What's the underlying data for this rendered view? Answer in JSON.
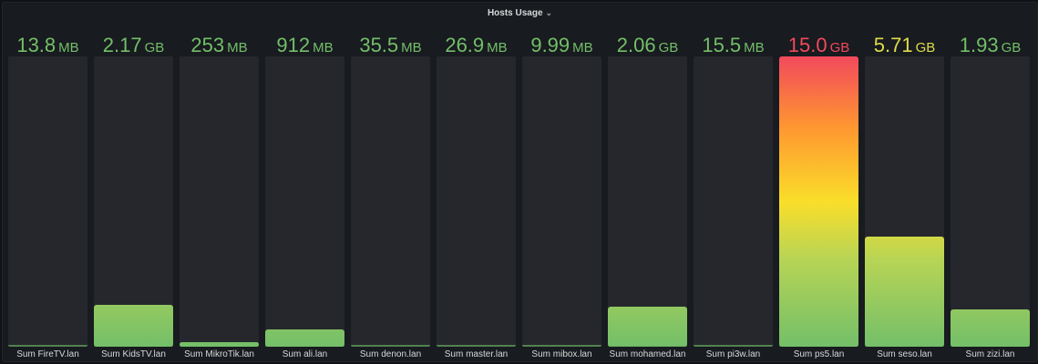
{
  "panel": {
    "title": "Hosts Usage",
    "chevron_icon": "chevron-down-icon"
  },
  "scale": {
    "min_gb": 0,
    "max_gb": 15.0
  },
  "colors": {
    "green": "#73bf69",
    "yellow": "#fade2a",
    "red": "#f2495c"
  },
  "bars": [
    {
      "label": "Sum FireTV.lan",
      "value": "13.8",
      "unit": "MB",
      "gb": 0.0138,
      "color": "#73bf69"
    },
    {
      "label": "Sum KidsTV.lan",
      "value": "2.17",
      "unit": "GB",
      "gb": 2.17,
      "color": "#73bf69"
    },
    {
      "label": "Sum MikroTik.lan",
      "value": "253",
      "unit": "MB",
      "gb": 0.253,
      "color": "#73bf69"
    },
    {
      "label": "Sum ali.lan",
      "value": "912",
      "unit": "MB",
      "gb": 0.912,
      "color": "#73bf69"
    },
    {
      "label": "Sum denon.lan",
      "value": "35.5",
      "unit": "MB",
      "gb": 0.0355,
      "color": "#73bf69"
    },
    {
      "label": "Sum master.lan",
      "value": "26.9",
      "unit": "MB",
      "gb": 0.0269,
      "color": "#73bf69"
    },
    {
      "label": "Sum mibox.lan",
      "value": "9.99",
      "unit": "MB",
      "gb": 0.00999,
      "color": "#73bf69"
    },
    {
      "label": "Sum mohamed.lan",
      "value": "2.06",
      "unit": "GB",
      "gb": 2.06,
      "color": "#73bf69"
    },
    {
      "label": "Sum pi3w.lan",
      "value": "15.5",
      "unit": "MB",
      "gb": 0.0155,
      "color": "#73bf69"
    },
    {
      "label": "Sum ps5.lan",
      "value": "15.0",
      "unit": "GB",
      "gb": 15.0,
      "color": "#f2495c"
    },
    {
      "label": "Sum seso.lan",
      "value": "5.71",
      "unit": "GB",
      "gb": 5.71,
      "color": "#e0dc4a"
    },
    {
      "label": "Sum zizi.lan",
      "value": "1.93",
      "unit": "GB",
      "gb": 1.93,
      "color": "#73bf69"
    }
  ]
}
